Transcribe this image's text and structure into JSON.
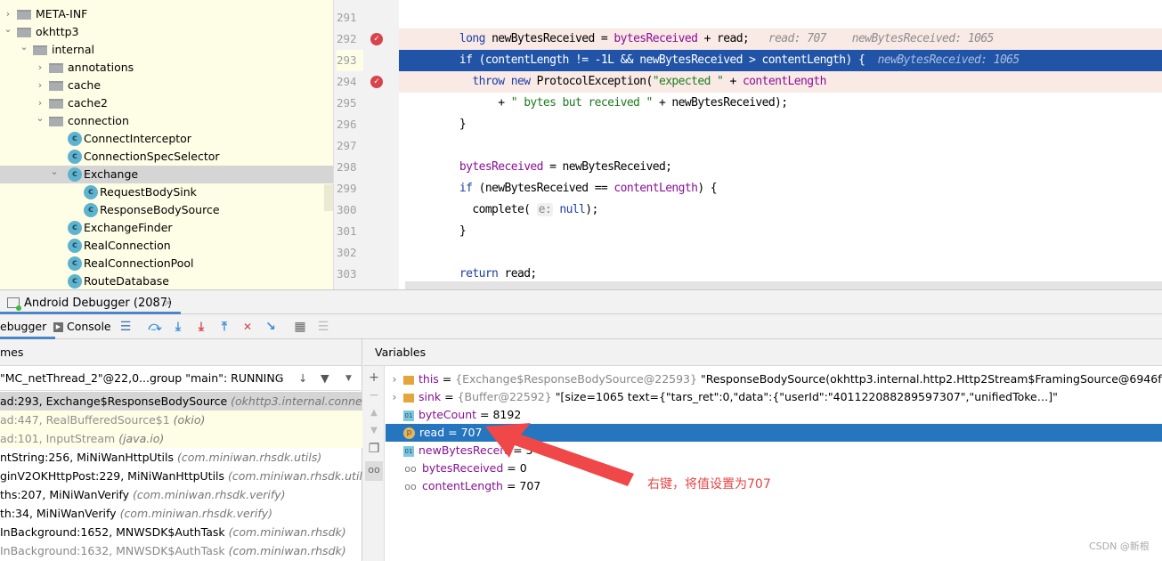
{
  "tree": [
    {
      "label": "META-INF",
      "type": "folder",
      "depth": 0,
      "open": false
    },
    {
      "label": "okhttp3",
      "type": "folder",
      "depth": 0,
      "open": true
    },
    {
      "label": "internal",
      "type": "folder",
      "depth": 1,
      "open": true
    },
    {
      "label": "annotations",
      "type": "folder",
      "depth": 2,
      "open": false
    },
    {
      "label": "cache",
      "type": "folder",
      "depth": 2,
      "open": false
    },
    {
      "label": "cache2",
      "type": "folder",
      "depth": 2,
      "open": false
    },
    {
      "label": "connection",
      "type": "folder",
      "depth": 2,
      "open": true
    },
    {
      "label": "ConnectInterceptor",
      "type": "class",
      "depth": 3
    },
    {
      "label": "ConnectionSpecSelector",
      "type": "class",
      "depth": 3
    },
    {
      "label": "Exchange",
      "type": "class",
      "depth": 3,
      "open": true,
      "selected": true
    },
    {
      "label": "RequestBodySink",
      "type": "class",
      "depth": 4
    },
    {
      "label": "ResponseBodySource",
      "type": "class",
      "depth": 4
    },
    {
      "label": "ExchangeFinder",
      "type": "class",
      "depth": 3
    },
    {
      "label": "RealConnection",
      "type": "class",
      "depth": 3
    },
    {
      "label": "RealConnectionPool",
      "type": "class",
      "depth": 3
    },
    {
      "label": "RouteDatabase",
      "type": "class",
      "depth": 3
    }
  ],
  "editor": {
    "lines": [
      {
        "n": "291",
        "seg": []
      },
      {
        "n": "292",
        "bp": "conditional",
        "seg": [
          [
            "    ",
            ""
          ],
          [
            "long",
            "kw"
          ],
          [
            " newBytesReceived = ",
            ""
          ],
          [
            "bytesReceived",
            "fld"
          ],
          [
            " + read;",
            ""
          ],
          [
            "   read: 707    newBytesReceived: 1065",
            "hint"
          ]
        ]
      },
      {
        "n": "293",
        "current": true,
        "seg": [
          [
            "    if (contentLength != -1L && newBytesReceived > contentLength) {",
            ""
          ],
          [
            "  newBytesReceived: 1065",
            "hint"
          ]
        ]
      },
      {
        "n": "294",
        "bp": "normal",
        "seg": [
          [
            "      ",
            ""
          ],
          [
            "throw",
            "kw"
          ],
          [
            " ",
            ""
          ],
          [
            "new",
            "kw"
          ],
          [
            " ProtocolException(",
            ""
          ],
          [
            "\"expected \"",
            "str"
          ],
          [
            " + ",
            ""
          ],
          [
            "contentLength",
            "fld"
          ]
        ]
      },
      {
        "n": "295",
        "seg": [
          [
            "          + ",
            ""
          ],
          [
            "\" bytes but received \"",
            "str"
          ],
          [
            " + newBytesReceived);",
            ""
          ]
        ]
      },
      {
        "n": "296",
        "seg": [
          [
            "    }",
            ""
          ]
        ]
      },
      {
        "n": "297",
        "seg": []
      },
      {
        "n": "298",
        "seg": [
          [
            "    ",
            ""
          ],
          [
            "bytesReceived",
            "fld"
          ],
          [
            " = newBytesReceived;",
            ""
          ]
        ]
      },
      {
        "n": "299",
        "seg": [
          [
            "    ",
            ""
          ],
          [
            "if",
            "kw"
          ],
          [
            " (newBytesReceived == ",
            ""
          ],
          [
            "contentLength",
            "fld"
          ],
          [
            ") {",
            ""
          ]
        ]
      },
      {
        "n": "300",
        "seg": [
          [
            "      complete( ",
            ""
          ],
          [
            "e:",
            "param"
          ],
          [
            " ",
            ""
          ],
          [
            "null",
            "kw"
          ],
          [
            ");",
            ""
          ]
        ]
      },
      {
        "n": "301",
        "seg": [
          [
            "    }",
            ""
          ]
        ]
      },
      {
        "n": "302",
        "seg": []
      },
      {
        "n": "303",
        "seg": [
          [
            "    ",
            ""
          ],
          [
            "return",
            "kw"
          ],
          [
            " read;",
            ""
          ]
        ]
      }
    ]
  },
  "debugger": {
    "tab_title": "Android Debugger (2087)",
    "tabs": {
      "debugger": "ebugger",
      "console": "Console"
    },
    "frames_header": "mes",
    "variables_header": "Variables",
    "thread": "\"MC_netThread_2\"@22,0...group \"main\": RUNNING",
    "frames": [
      {
        "method": "ad:293, Exchange$ResponseBodySource",
        "pkg": "(okhttp3.internal.connection)",
        "state": "selected"
      },
      {
        "method": "ad:447, RealBufferedSource$1",
        "pkg": "(okio)",
        "state": "lib"
      },
      {
        "method": "ad:101, InputStream",
        "pkg": "(java.io)",
        "state": "lib"
      },
      {
        "method": "ntString:256, MiNiWanHttpUtils",
        "pkg": "(com.miniwan.rhsdk.utils)",
        "state": ""
      },
      {
        "method": "ginV2OKHttpPost:229, MiNiWanHttpUtils",
        "pkg": "(com.miniwan.rhsdk.utils)",
        "state": ""
      },
      {
        "method": "ths:207, MiNiWanVerify",
        "pkg": "(com.miniwan.rhsdk.verify)",
        "state": ""
      },
      {
        "method": "th:34, MiNiWanVerify",
        "pkg": "(com.miniwan.rhsdk.verify)",
        "state": ""
      },
      {
        "method": "InBackground:1652, MNWSDK$AuthTask",
        "pkg": "(com.miniwan.rhsdk)",
        "state": ""
      },
      {
        "method": "InBackground:1632, MNWSDK$AuthTask",
        "pkg": "(com.miniwan.rhsdk)",
        "state": "dim"
      }
    ],
    "variables": [
      {
        "icon": "obj",
        "expandable": true,
        "name": "this",
        "type": "{Exchange$ResponseBodySource@22593}",
        "value": "\"ResponseBodySource(okhttp3.internal.http2.Http2Stream$FramingSource@6946f91)\""
      },
      {
        "icon": "obj",
        "expandable": true,
        "name": "sink",
        "type": "{Buffer@22592}",
        "value": "\"[size=1065 text={\"tars_ret\":0,\"data\":{\"userId\":\"401122088289597307\",\"unifiedToke…]\""
      },
      {
        "icon": "int",
        "name": "byteCount",
        "value": "8192"
      },
      {
        "icon": "p",
        "name": "read",
        "value": "707",
        "selected": true
      },
      {
        "icon": "int",
        "name": "newBytesReceiv",
        "value": "5"
      },
      {
        "icon": "w",
        "name": "bytesReceived",
        "value": "0"
      },
      {
        "icon": "w",
        "name": "contentLength",
        "value": "707"
      }
    ]
  },
  "annotation": "右键，将值设置为707",
  "watermark": "CSDN @新根",
  "colors": {
    "selection": "#2675bf",
    "current_line": "#2154a6",
    "arrow": "#f04848"
  }
}
